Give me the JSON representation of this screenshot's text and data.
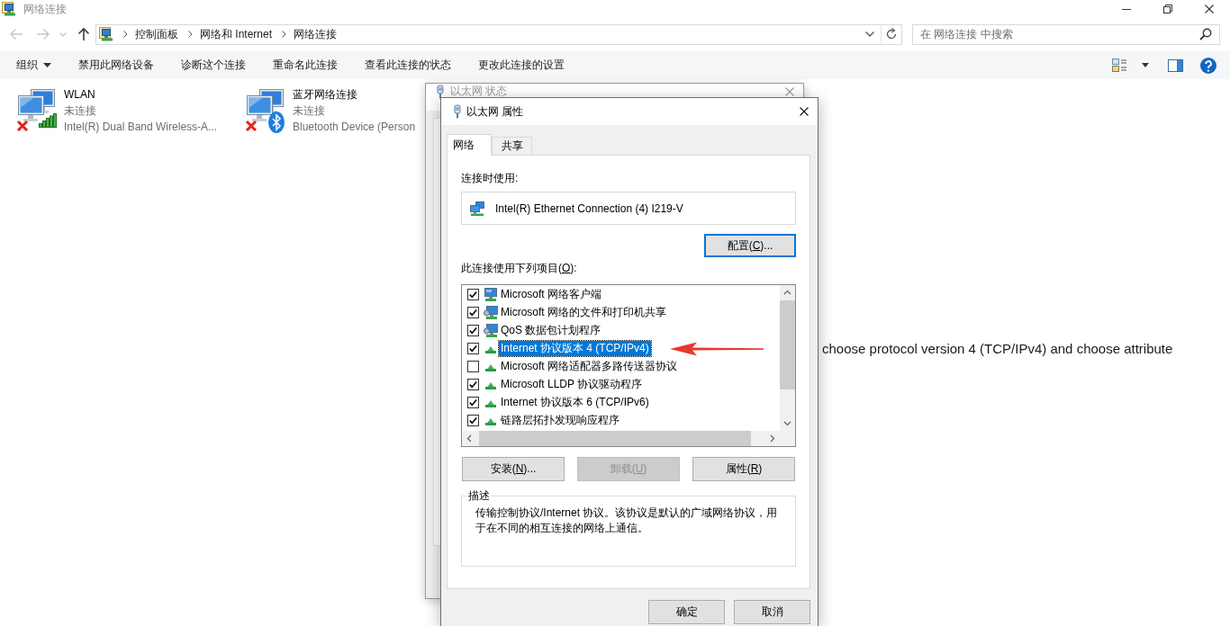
{
  "window": {
    "title": "网络连接"
  },
  "navigation": [
    {
      "kind": "back",
      "disabled": true
    },
    {
      "kind": "forward",
      "disabled": true
    },
    {
      "kind": "recent",
      "disabled": true
    },
    {
      "kind": "up",
      "disabled": false
    }
  ],
  "address_bar": {
    "path": [
      "控制面板",
      "网络和 Internet",
      "网络连接"
    ]
  },
  "search": {
    "placeholder": "在 网络连接 中搜索"
  },
  "command_bar": {
    "items": [
      {
        "label": "组织",
        "kind": "menu"
      },
      {
        "label": "禁用此网络设备",
        "kind": "action"
      },
      {
        "label": "诊断这个连接",
        "kind": "action"
      },
      {
        "label": "重命名此连接",
        "kind": "action"
      },
      {
        "label": "查看此连接的状态",
        "kind": "action"
      },
      {
        "label": "更改此连接的设置",
        "kind": "action"
      }
    ]
  },
  "connections": [
    {
      "name": "WLAN",
      "status": "未连接",
      "device": "Intel(R) Dual Band Wireless-A...",
      "kind": "wireless",
      "connected": false
    },
    {
      "name": "蓝牙网络连接",
      "status": "未连接",
      "device": "Bluetooth Device (Person",
      "kind": "bluetooth",
      "connected": false
    }
  ],
  "status_dialog": {
    "title": "以太网 状态"
  },
  "properties_dialog": {
    "title": "以太网 属性",
    "tabs": [
      {
        "label": "网络",
        "selected": true
      },
      {
        "label": "共享",
        "selected": false
      }
    ],
    "connect_using_label": "连接时使用:",
    "adapter": "Intel(R) Ethernet Connection (4) I219-V",
    "configure_button": {
      "prefix": "配置(",
      "access_key": "C",
      "suffix": ")...",
      "focused": true
    },
    "components_label": {
      "prefix": "此连接使用下列项目(",
      "access_key": "O",
      "suffix": "):"
    },
    "components": [
      {
        "label": "Microsoft 网络客户端",
        "kind": "client",
        "checked": true,
        "selected": false
      },
      {
        "label": "Microsoft 网络的文件和打印机共享",
        "kind": "service",
        "checked": true,
        "selected": false
      },
      {
        "label": "QoS 数据包计划程序",
        "kind": "service",
        "checked": true,
        "selected": false
      },
      {
        "label": "Internet 协议版本 4 (TCP/IPv4)",
        "kind": "protocol",
        "checked": true,
        "selected": true
      },
      {
        "label": "Microsoft 网络适配器多路传送器协议",
        "kind": "protocol",
        "checked": false,
        "selected": false
      },
      {
        "label": "Microsoft LLDP 协议驱动程序",
        "kind": "protocol",
        "checked": true,
        "selected": false
      },
      {
        "label": "Internet 协议版本 6 (TCP/IPv6)",
        "kind": "protocol",
        "checked": true,
        "selected": false
      },
      {
        "label": "链路层拓扑发现响应程序",
        "kind": "protocol",
        "checked": true,
        "selected": false
      }
    ],
    "buttons": [
      {
        "prefix": "安装(",
        "access_key": "N",
        "suffix": ")...",
        "disabled": false
      },
      {
        "prefix": "卸载(",
        "access_key": "U",
        "suffix": ")",
        "disabled": true
      },
      {
        "prefix": "属性(",
        "access_key": "R",
        "suffix": ")",
        "disabled": false
      }
    ],
    "description": {
      "label": "描述",
      "text": "传输控制协议/Internet 协议。该协议是默认的广域网络协议，用于在不同的相互连接的网络上通信。"
    },
    "footer_buttons": [
      {
        "label": "确定"
      },
      {
        "label": "取消"
      }
    ]
  },
  "annotation": {
    "text": "choose protocol version 4 (TCP/IPv4) and choose attribute"
  }
}
